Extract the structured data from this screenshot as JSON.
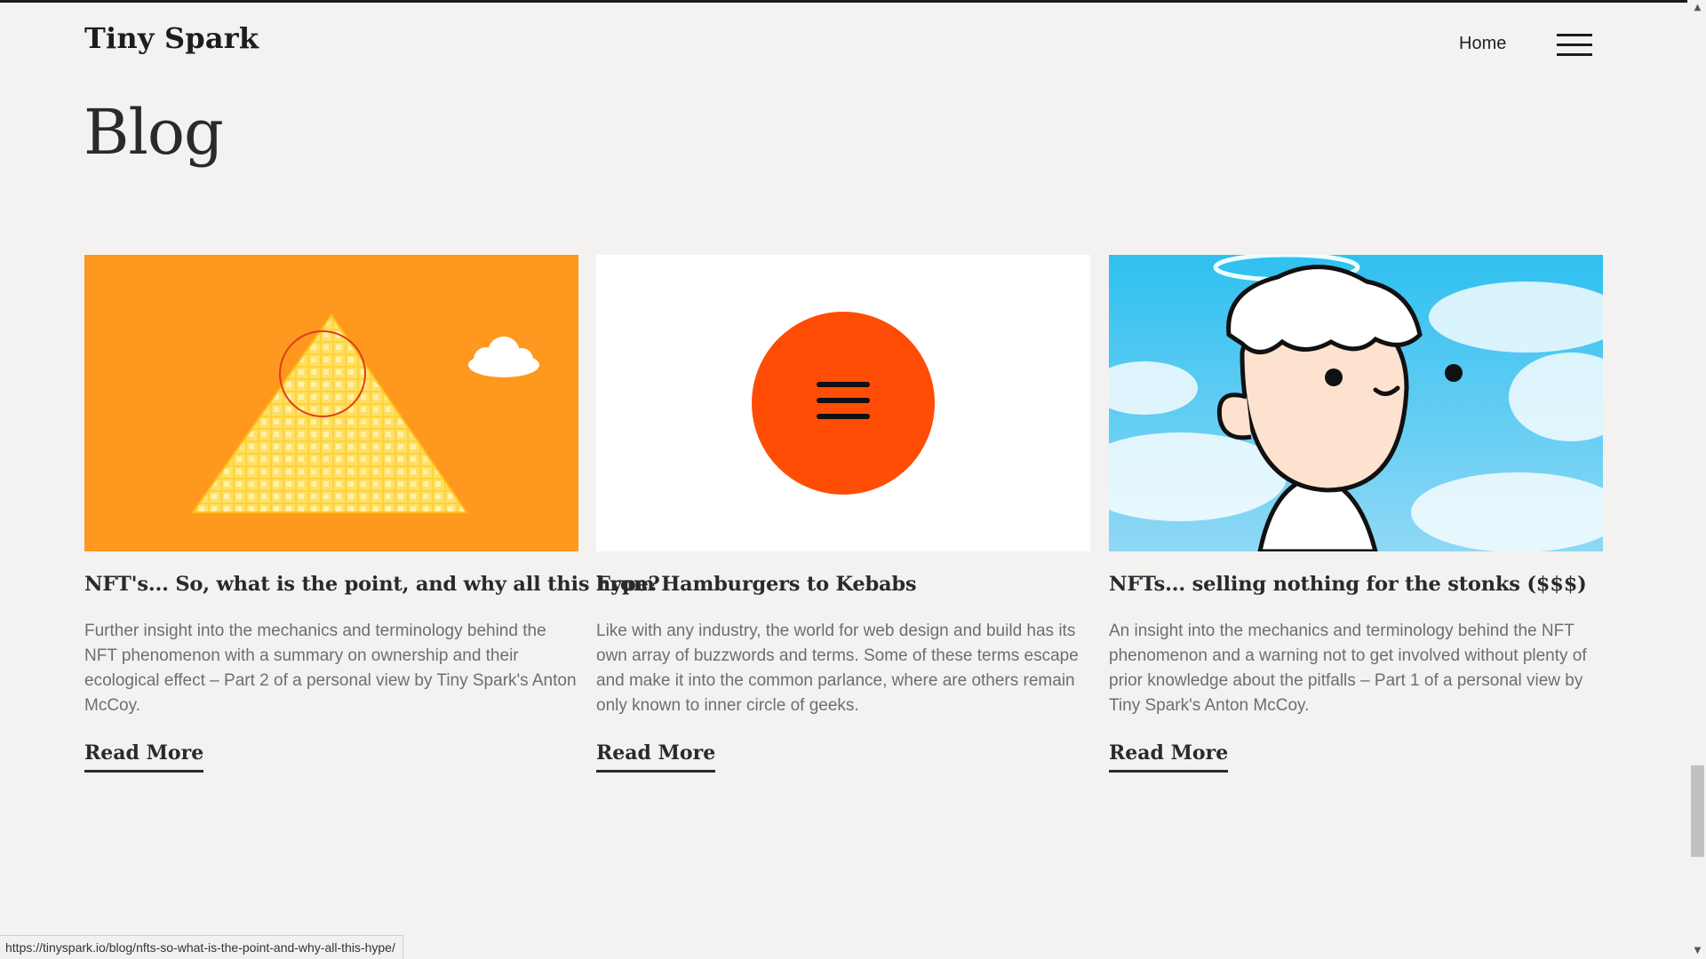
{
  "site": {
    "brand": "Tiny Spark",
    "nav_home": "Home"
  },
  "page": {
    "title": "Blog"
  },
  "posts": [
    {
      "title": "NFT's... So, what is the point, and why all this hype?",
      "excerpt": "Further insight into the mechanics and terminology behind the NFT phenomenon with a summary on ownership and their ecological effect – Part 2 of a personal view by Tiny Spark's Anton McCoy.",
      "read_more": "Read More",
      "image": "pyramid-of-gold-blocks-illustration"
    },
    {
      "title": "From Hamburgers to Kebabs",
      "excerpt": "Like with any industry, the world for web design and build has its own array of buzzwords and terms. Some of these terms escape and make it into the common parlance, where are others remain only known to inner circle of geeks.",
      "read_more": "Read More",
      "image": "orange-circle-hamburger-menu-icon"
    },
    {
      "title": "NFTs... selling nothing for the stonks ($$$)",
      "excerpt": "An insight into the mechanics and terminology behind the NFT phenomenon and a warning not to get involved without plenty of prior knowledge about the pitfalls – Part 1 of a personal view by Tiny Spark's Anton McCoy.",
      "read_more": "Read More",
      "image": "cartoon-character-with-halo-sky"
    }
  ],
  "status_bar": {
    "url": "https://tinyspark.io/blog/nfts-so-what-is-the-point-and-why-all-this-hype/"
  },
  "colors": {
    "background": "#f3f2f0",
    "orange_card": "#ff9a1f",
    "menu_circle": "#ff4d06",
    "sky": "#4cc9f0"
  }
}
